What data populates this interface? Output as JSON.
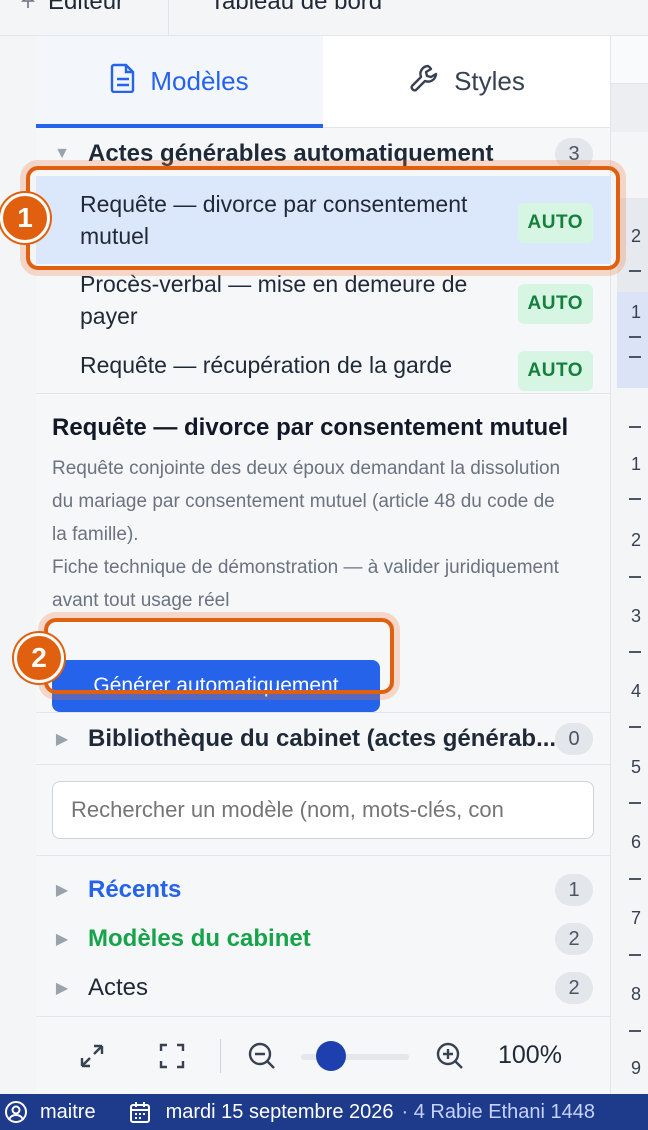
{
  "top_tabs": {
    "editor": "Éditeur",
    "dashboard": "Tableau de bord"
  },
  "panel_tabs": {
    "models": "Modèles",
    "styles": "Styles"
  },
  "auto_section": {
    "title": "Actes générables automatiquement",
    "count": "3",
    "items": [
      {
        "label": "Requête — divorce par consentement mutuel",
        "badge": "AUTO"
      },
      {
        "label": "Procès-verbal — mise en demeure de payer",
        "badge": "AUTO"
      },
      {
        "label": "Requête — récupération de la garde",
        "badge": "AUTO"
      }
    ]
  },
  "detail": {
    "title": "Requête — divorce par consentement mutuel",
    "description": "Requête conjointe des deux époux demandant la dissolution du mariage par consentement mutuel (article 48 du code de la famille).",
    "note": "Fiche technique de démonstration — à valider juridiquement avant tout usage réel",
    "button": "Générer automatiquement"
  },
  "library_section": {
    "title": "Bibliothèque du cabinet (actes générab...",
    "count": "0"
  },
  "search": {
    "placeholder": "Rechercher un modèle (nom, mots-clés, con"
  },
  "groups": [
    {
      "label": "Récents",
      "count": "1",
      "color": "#2563eb"
    },
    {
      "label": "Modèles du cabinet",
      "count": "2",
      "color": "#16a34a"
    },
    {
      "label": "Actes",
      "count": "2",
      "color": "#1f2937"
    }
  ],
  "zoom": {
    "level": "100%"
  },
  "ruler": [
    "2",
    "1",
    "1",
    "2",
    "3",
    "4",
    "5",
    "6",
    "7",
    "8",
    "9"
  ],
  "status": {
    "user": "maitre",
    "date": "mardi 15 septembre 2026",
    "hijri": "· 4 Rabie Ethani 1448"
  },
  "callouts": [
    "1",
    "2"
  ]
}
